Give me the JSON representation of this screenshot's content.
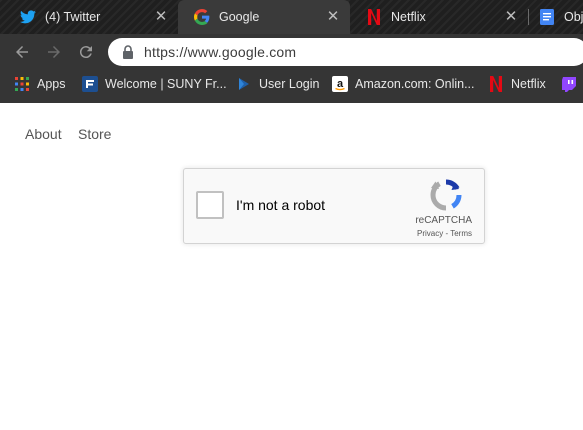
{
  "tabs": [
    {
      "title": "(4) Twitter",
      "icon": "twitter-icon"
    },
    {
      "title": "Google",
      "icon": "google-icon",
      "active": true
    },
    {
      "title": "Netflix",
      "icon": "netflix-icon"
    },
    {
      "title": "Obj",
      "icon": "docs-icon"
    }
  ],
  "toolbar": {
    "url": "https://www.google.com",
    "back_icon": "back-arrow-icon",
    "forward_icon": "forward-arrow-icon",
    "reload_icon": "reload-icon",
    "lock_icon": "lock-icon"
  },
  "bookmarks": [
    {
      "label": "Apps",
      "icon": "apps-grid-icon"
    },
    {
      "label": "Welcome | SUNY Fr...",
      "icon": "suny-icon"
    },
    {
      "label": "User Login",
      "icon": "user-login-icon"
    },
    {
      "label": "Amazon.com: Onlin...",
      "icon": "amazon-icon"
    },
    {
      "label": "Netflix",
      "icon": "netflix-icon"
    },
    {
      "label": "",
      "icon": "twitch-icon"
    }
  ],
  "page": {
    "nav": {
      "about": "About",
      "store": "Store"
    },
    "recaptcha": {
      "label": "I'm not a robot",
      "brand": "reCAPTCHA",
      "privacy": "Privacy",
      "separator": " - ",
      "terms": "Terms"
    }
  },
  "colors": {
    "tabstrip_bg": "#1f1f1f",
    "toolbar_bg": "#353535",
    "active_tab_bg": "#3a3a3a",
    "twitter_blue": "#1da1f2",
    "netflix_red": "#e50914",
    "recaptcha_blue": "#1c3aa9"
  }
}
